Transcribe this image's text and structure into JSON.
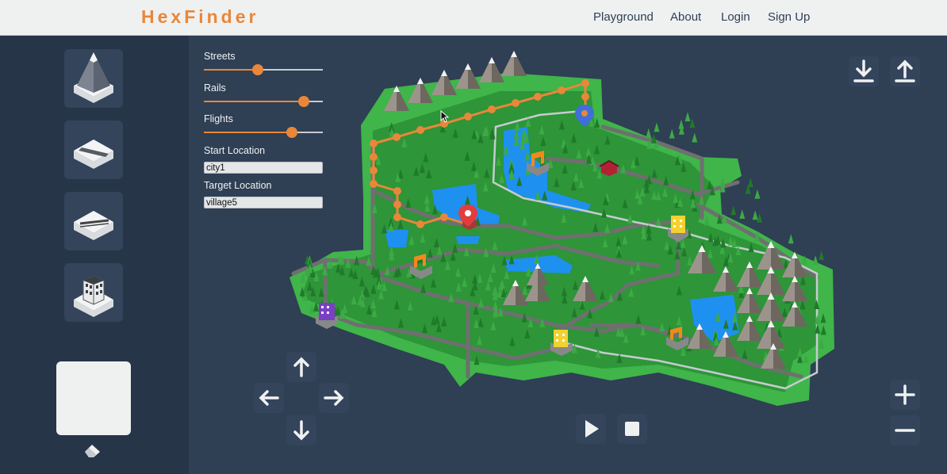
{
  "app": {
    "title": "HexFinder"
  },
  "nav": {
    "links": [
      "Playground",
      "About",
      "Login",
      "Sign Up"
    ]
  },
  "sidebar": {
    "tiles": [
      {
        "name": "mountain-tile",
        "icon": "mountain-icon"
      },
      {
        "name": "street-tile",
        "icon": "street-icon"
      },
      {
        "name": "rail-tile",
        "icon": "rail-icon"
      },
      {
        "name": "building-tile",
        "icon": "building-icon"
      }
    ],
    "eraser_icon": "eraser-icon"
  },
  "controls": {
    "streets": {
      "label": "Streets",
      "value": 0.45
    },
    "rails": {
      "label": "Rails",
      "value": 0.84
    },
    "flights": {
      "label": "Flights",
      "value": 0.74
    },
    "start": {
      "label": "Start Location",
      "value": "city1"
    },
    "target": {
      "label": "Target Location",
      "value": "village5"
    }
  },
  "toolbar": {
    "download_icon": "download-icon",
    "upload_icon": "upload-icon",
    "zoom_in_icon": "plus-icon",
    "zoom_out_icon": "minus-icon",
    "play_icon": "play-icon",
    "stop_icon": "stop-icon",
    "pan_icons": [
      "arrow-up-icon",
      "arrow-left-icon",
      "arrow-right-icon",
      "arrow-down-icon"
    ]
  },
  "colors": {
    "accent": "#e8873a",
    "background": "#2f3f54",
    "sidebar": "#273548",
    "grass": "#3fb54a",
    "forest": "#2c8f35",
    "water": "#1e90f0",
    "road": "#6f6f6f",
    "mountain": "#8a817a"
  }
}
